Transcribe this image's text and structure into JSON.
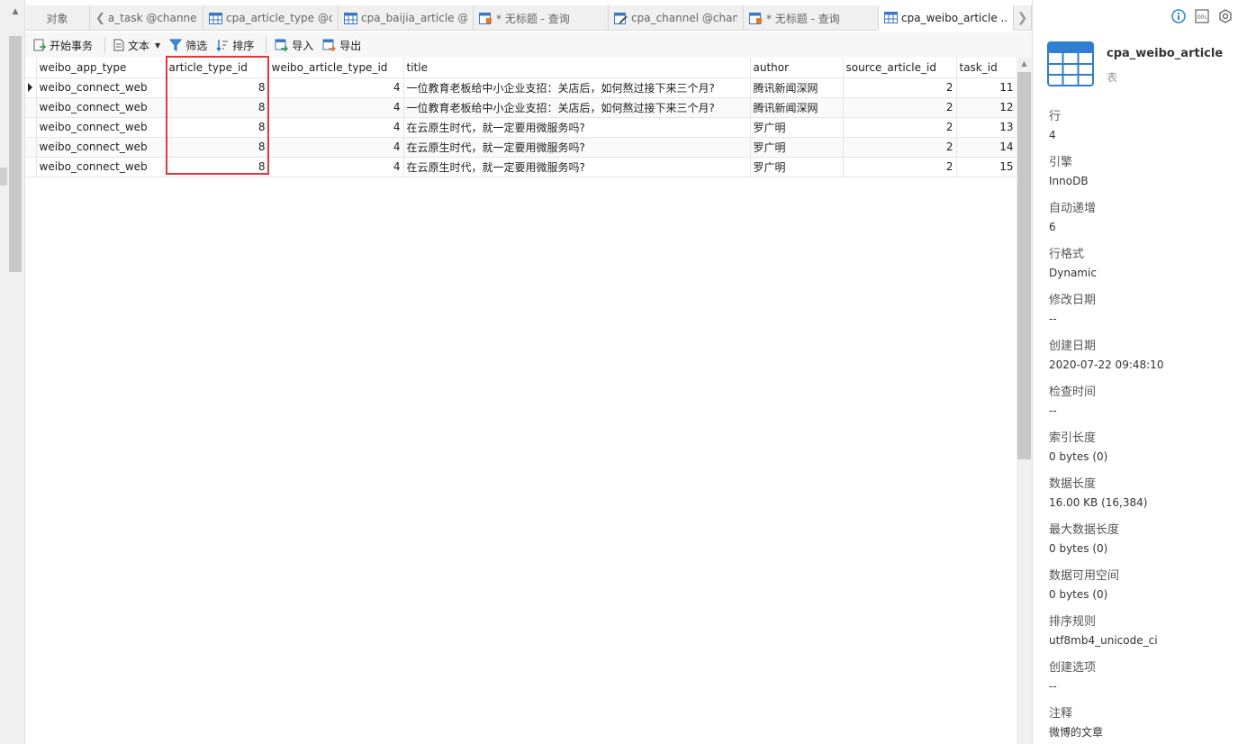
{
  "tabs": [
    {
      "label": "对象",
      "icon": "none"
    },
    {
      "label": "a_task @channel...",
      "icon": "table-icon"
    },
    {
      "label": "cpa_article_type @c...",
      "icon": "table-icon"
    },
    {
      "label": "cpa_baijia_article @...",
      "icon": "table-icon"
    },
    {
      "label": "* 无标题 - 查询",
      "icon": "query-icon"
    },
    {
      "label": "cpa_channel @chan...",
      "icon": "table-edit-icon"
    },
    {
      "label": "* 无标题 - 查询",
      "icon": "query-icon"
    },
    {
      "label": "cpa_weibo_article ...",
      "icon": "table-icon"
    }
  ],
  "toolbar": {
    "begin_transaction": "开始事务",
    "text": "文本",
    "filter": "筛选",
    "sort": "排序",
    "import": "导入",
    "export": "导出"
  },
  "grid": {
    "columns": [
      "weibo_app_type",
      "article_type_id",
      "weibo_article_type_id",
      "title",
      "author",
      "source_article_id",
      "task_id"
    ],
    "rows": [
      [
        "weibo_connect_web",
        "8",
        "4",
        "一位教育老板给中小企业支招：关店后，如何熬过接下来三个月?",
        "腾讯新闻深网",
        "2",
        "11"
      ],
      [
        "weibo_connect_web",
        "8",
        "4",
        "一位教育老板给中小企业支招：关店后，如何熬过接下来三个月?",
        "腾讯新闻深网",
        "2",
        "12"
      ],
      [
        "weibo_connect_web",
        "8",
        "4",
        "在云原生时代，就一定要用微服务吗?",
        "罗广明",
        "2",
        "13"
      ],
      [
        "weibo_connect_web",
        "8",
        "4",
        "在云原生时代，就一定要用微服务吗?",
        "罗广明",
        "2",
        "14"
      ],
      [
        "weibo_connect_web",
        "8",
        "4",
        "在云原生时代，就一定要用微服务吗?",
        "罗广明",
        "2",
        "15"
      ]
    ]
  },
  "panel": {
    "title": "cpa_weibo_article",
    "subtitle": "表",
    "properties": [
      {
        "key": "行",
        "value": "4"
      },
      {
        "key": "引擎",
        "value": "InnoDB"
      },
      {
        "key": "自动递增",
        "value": "6"
      },
      {
        "key": "行格式",
        "value": "Dynamic"
      },
      {
        "key": "修改日期",
        "value": "--"
      },
      {
        "key": "创建日期",
        "value": "2020-07-22 09:48:10"
      },
      {
        "key": "检查时间",
        "value": "--"
      },
      {
        "key": "索引长度",
        "value": "0 bytes (0)"
      },
      {
        "key": "数据长度",
        "value": "16.00 KB (16,384)"
      },
      {
        "key": "最大数据长度",
        "value": "0 bytes (0)"
      },
      {
        "key": "数据可用空间",
        "value": "0 bytes (0)"
      },
      {
        "key": "排序规则",
        "value": "utf8mb4_unicode_ci"
      },
      {
        "key": "创建选项",
        "value": "--"
      },
      {
        "key": "注释",
        "value": "微博的文章"
      }
    ]
  },
  "colors": {
    "highlight": "#e0393c",
    "tab_active": "#ffffff",
    "icon_blue": "#2f7fd1"
  }
}
